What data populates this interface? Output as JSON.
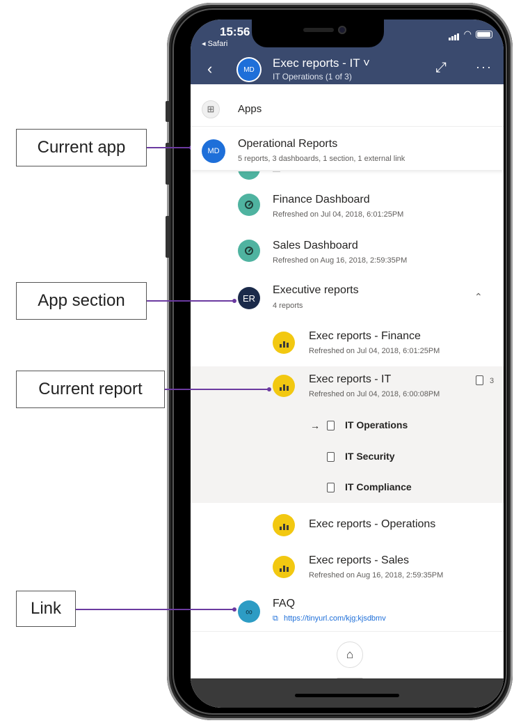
{
  "status": {
    "time": "15:56",
    "back_app": "◂ Safari"
  },
  "header": {
    "avatar_initials": "MD",
    "title": "Exec reports - IT ˅",
    "subtitle": "IT Operations (1 of 3)"
  },
  "apps_row": {
    "label": "Apps"
  },
  "current_app": {
    "initials": "MD",
    "title": "Operational Reports",
    "subtitle": "5 reports, 3 dashboards, 1 section, 1 external link"
  },
  "items": {
    "finance_dashboard": {
      "title": "Finance Dashboard",
      "subtitle": "Refreshed on Jul 04, 2018, 6:01:25PM"
    },
    "sales_dashboard": {
      "title": "Sales Dashboard",
      "subtitle": "Refreshed on Aug 16, 2018, 2:59:35PM"
    },
    "exec_section": {
      "initials": "ER",
      "title": "Executive reports",
      "subtitle": "4 reports"
    },
    "exec_finance": {
      "title": "Exec reports - Finance",
      "subtitle": "Refreshed on Jul 04, 2018, 6:01:25PM"
    },
    "exec_it": {
      "title": "Exec reports - IT",
      "subtitle": "Refreshed on Jul 04, 2018, 6:00:08PM",
      "page_count": "3"
    },
    "exec_operations": {
      "title": "Exec reports - Operations"
    },
    "exec_sales": {
      "title": "Exec reports - Sales",
      "subtitle": "Refreshed on Aug 16, 2018, 2:59:35PM"
    },
    "faq": {
      "title": "FAQ",
      "url": "https://tinyurl.com/kjg;kjsdbmv"
    }
  },
  "pages": [
    "IT Operations",
    "IT Security",
    "IT Compliance"
  ],
  "callouts": {
    "current_app": "Current app",
    "app_section": "App section",
    "current_report": "Current report",
    "link": "Link"
  },
  "colors": {
    "header": "#3a4a6e",
    "accent_blue": "#1e6fd9",
    "dashboard_teal": "#4fb3a0",
    "report_yellow": "#f2c811",
    "section_navy": "#1b2a4a",
    "callout_line": "#6b3aa0"
  }
}
